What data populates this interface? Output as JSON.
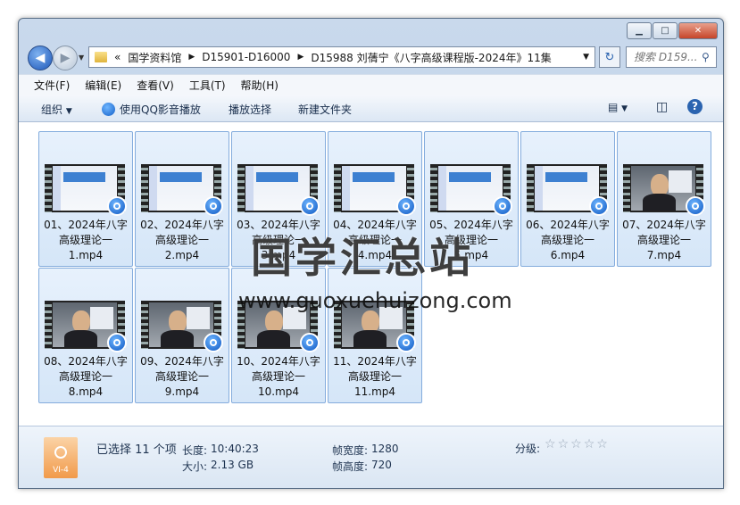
{
  "window": {
    "buttons": {
      "minimize": "▁",
      "maximize": "□",
      "close": "✕"
    }
  },
  "nav": {
    "chevrons": "«",
    "breadcrumb": [
      "国学资料馆",
      "D15901-D16000",
      "D15988 刘蒨宁《八字高级课程版-2024年》11集"
    ],
    "search_placeholder": "搜索 D159..."
  },
  "menu": [
    "文件(F)",
    "编辑(E)",
    "查看(V)",
    "工具(T)",
    "帮助(H)"
  ],
  "toolbar": {
    "organize": "组织",
    "play_qq": "使用QQ影音播放",
    "play_selection": "播放选择",
    "new_folder": "新建文件夹"
  },
  "files": [
    {
      "name": "01、2024年八字高级理论一1.mp4",
      "line1": "01、2024年八字",
      "line2": "高级理论一",
      "line3": "1.mp4",
      "thumb": "slide"
    },
    {
      "name": "02、2024年八字高级理论一2.mp4",
      "line1": "02、2024年八字",
      "line2": "高级理论一",
      "line3": "2.mp4",
      "thumb": "slide"
    },
    {
      "name": "03、2024年八字高级理论一3.mp4",
      "line1": "03、2024年八字",
      "line2": "高级理论一",
      "line3": "3.mp4",
      "thumb": "slide"
    },
    {
      "name": "04、2024年八字高级理论一4.mp4",
      "line1": "04、2024年八字",
      "line2": "高级理论一",
      "line3": "4.mp4",
      "thumb": "slide"
    },
    {
      "name": "05、2024年八字高级理论一5.mp4",
      "line1": "05、2024年八字",
      "line2": "高级理论一",
      "line3": "5.mp4",
      "thumb": "slide"
    },
    {
      "name": "06、2024年八字高级理论一6.mp4",
      "line1": "06、2024年八字",
      "line2": "高级理论一",
      "line3": "6.mp4",
      "thumb": "slide"
    },
    {
      "name": "07、2024年八字高级理论一7.mp4",
      "line1": "07、2024年八字",
      "line2": "高级理论一",
      "line3": "7.mp4",
      "thumb": "person"
    },
    {
      "name": "08、2024年八字高级理论一8.mp4",
      "line1": "08、2024年八字",
      "line2": "高级理论一",
      "line3": "8.mp4",
      "thumb": "person"
    },
    {
      "name": "09、2024年八字高级理论一9.mp4",
      "line1": "09、2024年八字",
      "line2": "高级理论一",
      "line3": "9.mp4",
      "thumb": "person"
    },
    {
      "name": "10、2024年八字高级理论一10.mp4",
      "line1": "10、2024年八字",
      "line2": "高级理论一",
      "line3": "10.mp4",
      "thumb": "person"
    },
    {
      "name": "11、2024年八字高级理论一11.mp4",
      "line1": "11、2024年八字",
      "line2": "高级理论一",
      "line3": "11.mp4",
      "thumb": "person"
    }
  ],
  "watermark": {
    "cn": "国学汇总站",
    "url": "www.guoxuehuizong.com"
  },
  "details": {
    "selected": "已选择 11 个项",
    "length_label": "长度:",
    "length": "10:40:23",
    "size_label": "大小:",
    "size": "2.13 GB",
    "frame_width_label": "帧宽度:",
    "frame_width": "1280",
    "frame_height_label": "帧高度:",
    "frame_height": "720",
    "rating_label": "分级:",
    "rating": 0,
    "file_icon_label": "VI-4"
  }
}
